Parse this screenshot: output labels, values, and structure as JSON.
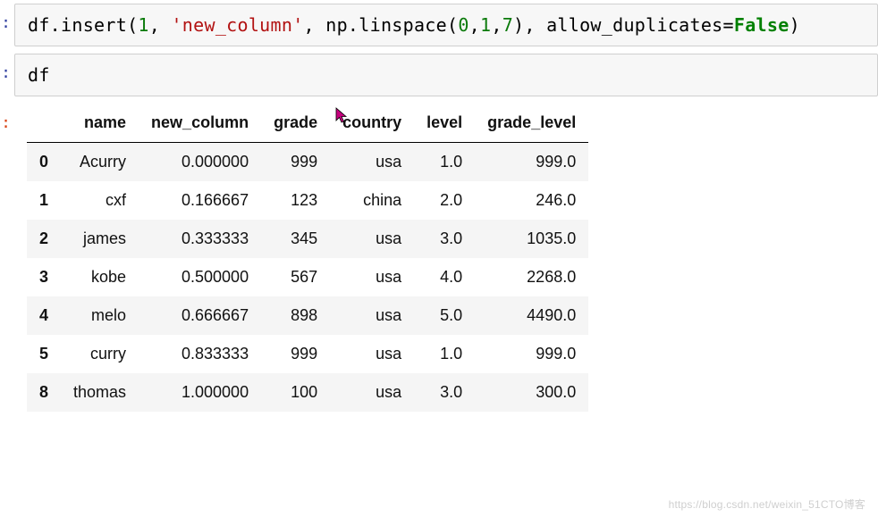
{
  "cells": {
    "code1": {
      "parts": {
        "p1": "df.insert(",
        "n1": "1",
        "comma1": ", ",
        "s1": "'new_column'",
        "comma2": ", ",
        "p2": "np.linspace(",
        "n2": "0",
        "comma3": ",",
        "n3": "1",
        "comma4": ",",
        "n4": "7",
        "close1": "), allow_duplicates=",
        "kw": "False",
        "close2": ")"
      }
    },
    "code2": "df"
  },
  "table": {
    "headers": [
      "",
      "name",
      "new_column",
      "grade",
      "country",
      "level",
      "grade_level"
    ],
    "rows": [
      {
        "idx": "0",
        "name": "Acurry",
        "new_column": "0.000000",
        "grade": "999",
        "country": "usa",
        "level": "1.0",
        "grade_level": "999.0"
      },
      {
        "idx": "1",
        "name": "cxf",
        "new_column": "0.166667",
        "grade": "123",
        "country": "china",
        "level": "2.0",
        "grade_level": "246.0"
      },
      {
        "idx": "2",
        "name": "james",
        "new_column": "0.333333",
        "grade": "345",
        "country": "usa",
        "level": "3.0",
        "grade_level": "1035.0"
      },
      {
        "idx": "3",
        "name": "kobe",
        "new_column": "0.500000",
        "grade": "567",
        "country": "usa",
        "level": "4.0",
        "grade_level": "2268.0"
      },
      {
        "idx": "4",
        "name": "melo",
        "new_column": "0.666667",
        "grade": "898",
        "country": "usa",
        "level": "5.0",
        "grade_level": "4490.0"
      },
      {
        "idx": "5",
        "name": "curry",
        "new_column": "0.833333",
        "grade": "999",
        "country": "usa",
        "level": "1.0",
        "grade_level": "999.0"
      },
      {
        "idx": "8",
        "name": "thomas",
        "new_column": "1.000000",
        "grade": "100",
        "country": "usa",
        "level": "3.0",
        "grade_level": "300.0"
      }
    ]
  },
  "prompt_symbol": ":",
  "watermark": "https://blog.csdn.net/weixin_51CTO博客"
}
